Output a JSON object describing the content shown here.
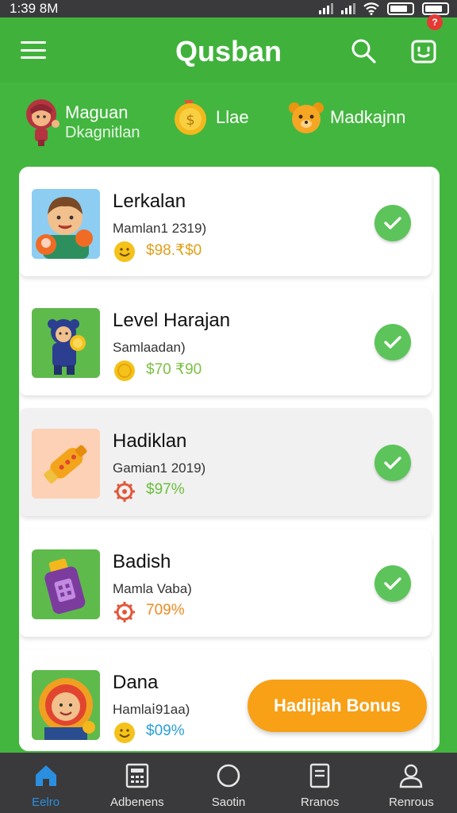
{
  "status_bar": {
    "time": "1:39 8M"
  },
  "app_bar": {
    "title": "Qusban",
    "notification_count": "?"
  },
  "categories": [
    {
      "line1": "Maguan",
      "line2": "Dkagnitlan",
      "icon": "girl-avatar-icon"
    },
    {
      "line1": "Llae",
      "line2": "",
      "icon": "medal-icon"
    },
    {
      "line1": "Madkajnn",
      "line2": "",
      "icon": "bear-icon"
    }
  ],
  "items": [
    {
      "title": "Lerkalan",
      "subtitle": "Mamlan1 2319)",
      "price": "$98.₹$0",
      "price_color": "#e0a01a",
      "icon": "boy-character-icon",
      "coin_icon": "smiley-coin-icon"
    },
    {
      "title": "Level Harajan",
      "subtitle": "Samlaadan)",
      "price": "$70 ₹90",
      "price_color": "#7bc043",
      "icon": "blue-character-icon",
      "coin_icon": "gold-coin-icon"
    },
    {
      "title": "Hadiklan",
      "subtitle": "Gamian1 2019)",
      "price": "$97%",
      "price_color": "#6abf3c",
      "icon": "rocket-toy-icon",
      "coin_icon": "gear-icon"
    },
    {
      "title": "Badish",
      "subtitle": "Mamla Vaba)",
      "price": "709%",
      "price_color": "#f08a20",
      "icon": "potion-bottle-icon",
      "coin_icon": "gear-icon"
    },
    {
      "title": "Dana",
      "subtitle": "Hamlaⅰ91aa)",
      "price": "$09%",
      "price_color": "#2a9fd8",
      "icon": "hooded-character-icon",
      "coin_icon": "smiley-coin-icon"
    }
  ],
  "bonus_button": "Hadijiah Bonus",
  "tabs": [
    {
      "label": "Eelro",
      "icon": "home-icon",
      "active": true
    },
    {
      "label": "Adbenens",
      "icon": "calculator-icon",
      "active": false
    },
    {
      "label": "Saotin",
      "icon": "circle-icon",
      "active": false
    },
    {
      "label": "Rranos",
      "icon": "document-icon",
      "active": false
    },
    {
      "label": "Renrous",
      "icon": "person-icon",
      "active": false
    }
  ],
  "colors": {
    "primary_green": "#43b63f",
    "check_green": "#5cc45a",
    "bonus_orange": "#f8a016",
    "tab_active": "#2b8fe0",
    "dark_bar": "#3a3a3c"
  }
}
